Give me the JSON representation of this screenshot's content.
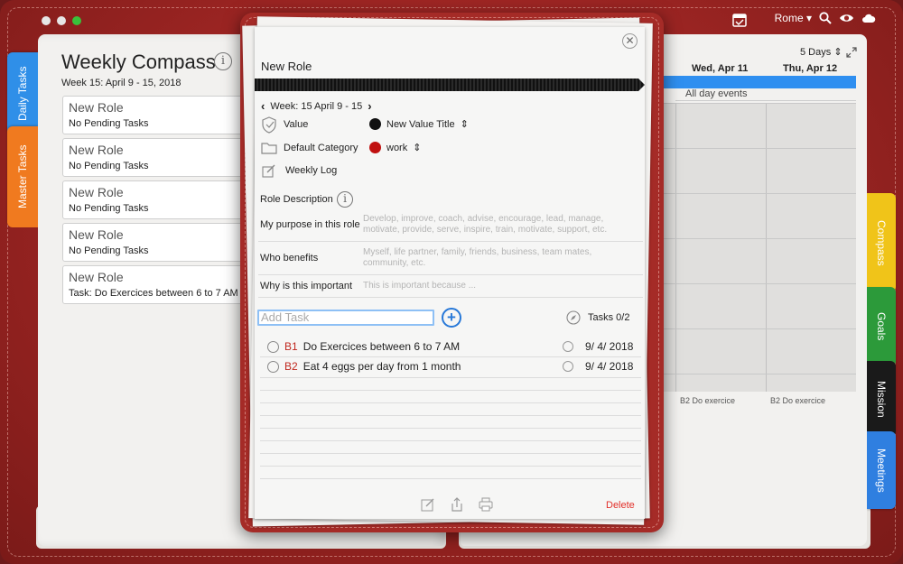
{
  "window": {
    "traffic_colors": [
      "#e6e6e6",
      "#e6e6e6",
      "#39c23b"
    ]
  },
  "menubar": {
    "city": "Rome"
  },
  "left_page": {
    "title": "Weekly Compass",
    "week": "Week 15: April 9 - 15, 2018",
    "roles": [
      {
        "name": "New Role",
        "status": "No Pending Tasks"
      },
      {
        "name": "New Role",
        "status": "No Pending Tasks"
      },
      {
        "name": "New Role",
        "status": "No Pending Tasks"
      },
      {
        "name": "New Role",
        "status": "No Pending Tasks"
      },
      {
        "name": "New Role",
        "status": "Task: Do Exercices between 6 to 7 AM"
      }
    ]
  },
  "left_tabs": [
    {
      "label": "Daily Tasks",
      "color": "#2f8fe8"
    },
    {
      "label": "Master Tasks",
      "color": "#f07a1f"
    }
  ],
  "right_tabs": [
    {
      "label": "Compass",
      "color": "#f0c419"
    },
    {
      "label": "Goals",
      "color": "#2c9a3a"
    },
    {
      "label": "Mission",
      "color": "#1a1a1a"
    },
    {
      "label": "Meetings",
      "color": "#2f7fe0"
    }
  ],
  "calendar": {
    "view": "5 Days",
    "days": [
      "Wed, Apr 11",
      "Thu, Apr 12"
    ],
    "all_day": "All day events",
    "events": [
      "B2  Do exercice",
      "B2  Do exercice"
    ]
  },
  "modal": {
    "title": "New Role",
    "week": "Week: 15 April 9 - 15",
    "value_label": "Value",
    "value_text": "New Value Title",
    "value_color": "#111111",
    "category_label": "Default Category",
    "category_text": "work",
    "category_color": "#c0100f",
    "weekly_log": "Weekly Log",
    "role_description": "Role Description",
    "fields": [
      {
        "label": "My purpose in this role",
        "placeholder": "Develop, improve, coach, advise, encourage, lead, manage, motivate, provide, serve, inspire, train, motivate, support, etc."
      },
      {
        "label": "Who benefits",
        "placeholder": "Myself, life partner, family, friends, business, team mates, community, etc."
      },
      {
        "label": "Why is this important",
        "placeholder": "This is important because ..."
      }
    ],
    "add_task_placeholder": "Add Task",
    "tasks_count": "Tasks 0/2",
    "tasks": [
      {
        "code": "B1",
        "text": "Do Exercices between 6 to 7 AM",
        "date": "9/ 4/ 2018"
      },
      {
        "code": "B2",
        "text": "Eat 4 eggs per day from 1 month",
        "date": "9/ 4/ 2018"
      }
    ],
    "delete": "Delete"
  }
}
